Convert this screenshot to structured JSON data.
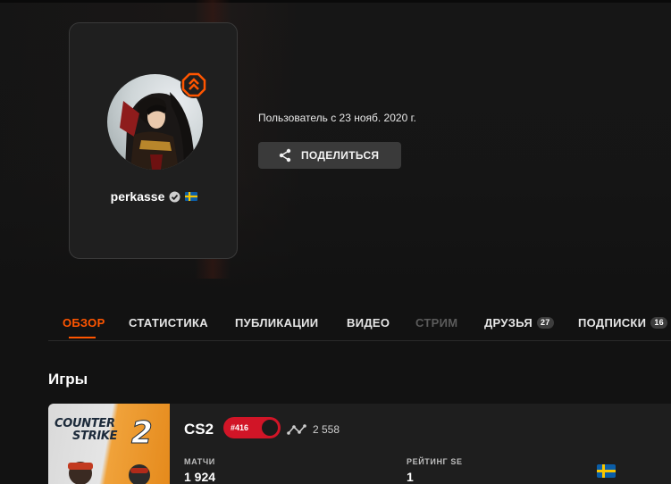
{
  "profile": {
    "username": "perkasse",
    "verified_icon": "verified-check-icon",
    "country_flag": "sweden-flag-icon",
    "level_icon": "level-chevron-icon",
    "member_since": "Пользователь с 23 нояб. 2020 г.",
    "share_label": "ПОДЕЛИТЬСЯ",
    "share_icon": "share-icon"
  },
  "tabs": [
    {
      "label": "ОБЗОР",
      "active": true
    },
    {
      "label": "СТАТИСТИКА"
    },
    {
      "label": "ПУБЛИКАЦИИ"
    },
    {
      "label": "ВИДЕО"
    },
    {
      "label": "СТРИМ",
      "disabled": true
    },
    {
      "label": "ДРУЗЬЯ",
      "count": "27"
    },
    {
      "label": "ПОДПИСКИ",
      "count": "16"
    }
  ],
  "games_section": {
    "title": "Игры",
    "game": {
      "art_line1": "COUNTER",
      "art_line2": "STRIKE",
      "art_number": "2",
      "name": "CS2",
      "rank": "#416",
      "elo": "2 558",
      "elo_icon": "elo-graph-icon",
      "matches_label": "МАТЧИ",
      "matches_value": "1 924",
      "rating_label": "РЕЙТИНГ SE",
      "rating_value": "1",
      "region_flag": "sweden-flag-icon"
    }
  },
  "colors": {
    "accent": "#ff5500",
    "rank_red": "#d11527",
    "background": "#121212",
    "card": "#1f1f1f"
  }
}
